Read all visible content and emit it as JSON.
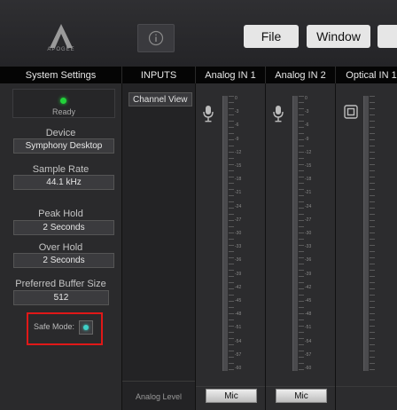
{
  "app": {
    "logo_text": "APOGEE",
    "menu": {
      "file": "File",
      "window": "Window"
    }
  },
  "headers": {
    "system": "System Settings",
    "inputs": "INPUTS",
    "ch1": "Analog IN 1",
    "ch2": "Analog IN 2",
    "ch3": "Optical IN 1"
  },
  "system": {
    "status": "Ready",
    "device_label": "Device",
    "device_value": "Symphony Desktop",
    "sample_rate_label": "Sample Rate",
    "sample_rate_value": "44.1 kHz",
    "peak_hold_label": "Peak Hold",
    "peak_hold_value": "2 Seconds",
    "over_hold_label": "Over Hold",
    "over_hold_value": "2 Seconds",
    "buffer_label": "Preferred Buffer Size",
    "buffer_value": "512",
    "safe_mode_label": "Safe Mode:"
  },
  "inputs": {
    "channel_view": "Channel View",
    "analog_level": "Analog Level"
  },
  "meter_scale": [
    "0",
    "-3",
    "-6",
    "-9",
    "-12",
    "-15",
    "-18",
    "-21",
    "-24",
    "-27",
    "-30",
    "-33",
    "-36",
    "-39",
    "-42",
    "-45",
    "-48",
    "-51",
    "-54",
    "-57",
    "-60"
  ],
  "channels": {
    "ch1_level": "Mic",
    "ch2_level": "Mic"
  },
  "colors": {
    "ready_led": "#22d23a",
    "safe_mode_indicator": "#3fd0c8",
    "highlight": "#e01818"
  },
  "icons": {
    "info": "info-icon",
    "mic": "microphone-icon",
    "optical": "optical-icon"
  }
}
